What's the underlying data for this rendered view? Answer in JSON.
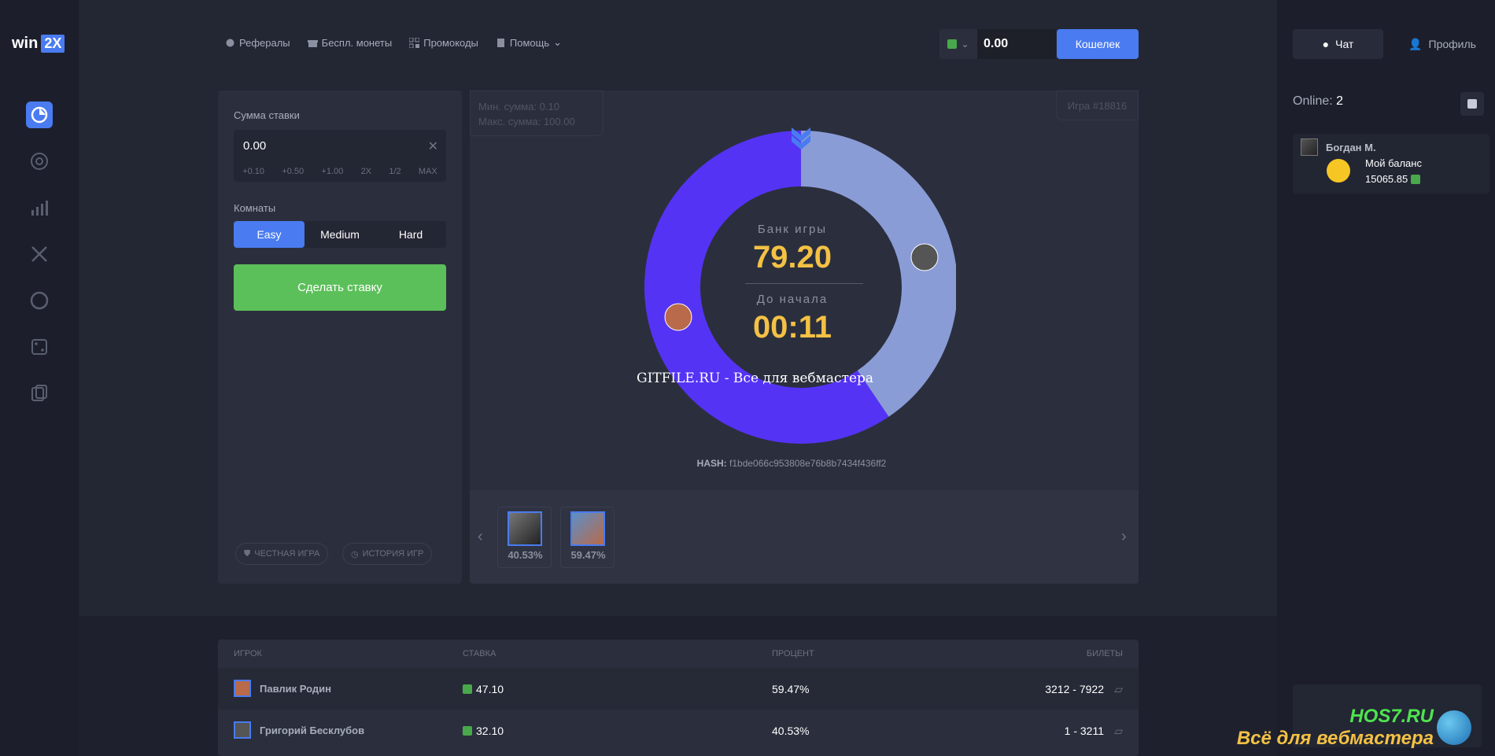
{
  "app": {
    "logo_text": "win",
    "logo_badge": "2X"
  },
  "topnav": {
    "items": [
      {
        "label": "Рефералы",
        "icon": "referral-icon"
      },
      {
        "label": "Беспл. монеты",
        "icon": "gift-icon"
      },
      {
        "label": "Промокоды",
        "icon": "qr-icon"
      },
      {
        "label": "Помощь",
        "icon": "help-icon"
      }
    ]
  },
  "balance": {
    "value": "0.00",
    "wallet_label": "Кошелек"
  },
  "rightbar": {
    "chat_tab": "Чат",
    "profile_tab": "Профиль",
    "online_label": "Online:",
    "online_count": "2",
    "message": {
      "name": "Богдан М.",
      "text": "Мой баланс",
      "amount": "15065.85"
    }
  },
  "bet": {
    "amount_label": "Сумма ставки",
    "amount_value": "0.00",
    "quick": [
      "+0.10",
      "+0.50",
      "+1.00",
      "2X",
      "1/2",
      "MAX"
    ],
    "rooms_label": "Комнаты",
    "rooms": [
      "Easy",
      "Medium",
      "Hard"
    ],
    "make_bet": "Сделать ставку",
    "fair_game": "ЧЕСТНАЯ ИГРА",
    "history": "ИСТОРИЯ ИГР"
  },
  "game": {
    "min_sum": "Мин. сумма: 0.10",
    "max_sum": "Макс. сумма: 100.00",
    "game_number": "Игра #18816",
    "bank_label": "Банк игры",
    "bank_value": "79.20",
    "start_label": "До начала",
    "start_value": "00:11",
    "watermark": "GITFILE.RU - Все для вебмастера",
    "hash_label": "HASH:",
    "hash_value": "f1bde066c953808e76b8b7434f436ff2",
    "slices": [
      {
        "player": "Григорий Бесклубов",
        "share": 0.4053,
        "color": "#8a9cd6"
      },
      {
        "player": "Павлик Родин",
        "share": 0.5947,
        "color": "#5533f5"
      }
    ],
    "cards": [
      "40.53%",
      "59.47%"
    ]
  },
  "table": {
    "headers": [
      "ИГРОК",
      "СТАВКА",
      "ПРОЦЕНТ",
      "БИЛЕТЫ"
    ],
    "rows": [
      {
        "player": "Павлик Родин",
        "bet": "47.10",
        "percent": "59.47%",
        "tickets": "3212 - 7922"
      },
      {
        "player": "Григорий Бесклубов",
        "bet": "32.10",
        "percent": "40.53%",
        "tickets": "1 - 3211"
      }
    ]
  },
  "footer_logo": {
    "top": "HOS7.RU",
    "bottom": "Всё для вебмастера"
  }
}
